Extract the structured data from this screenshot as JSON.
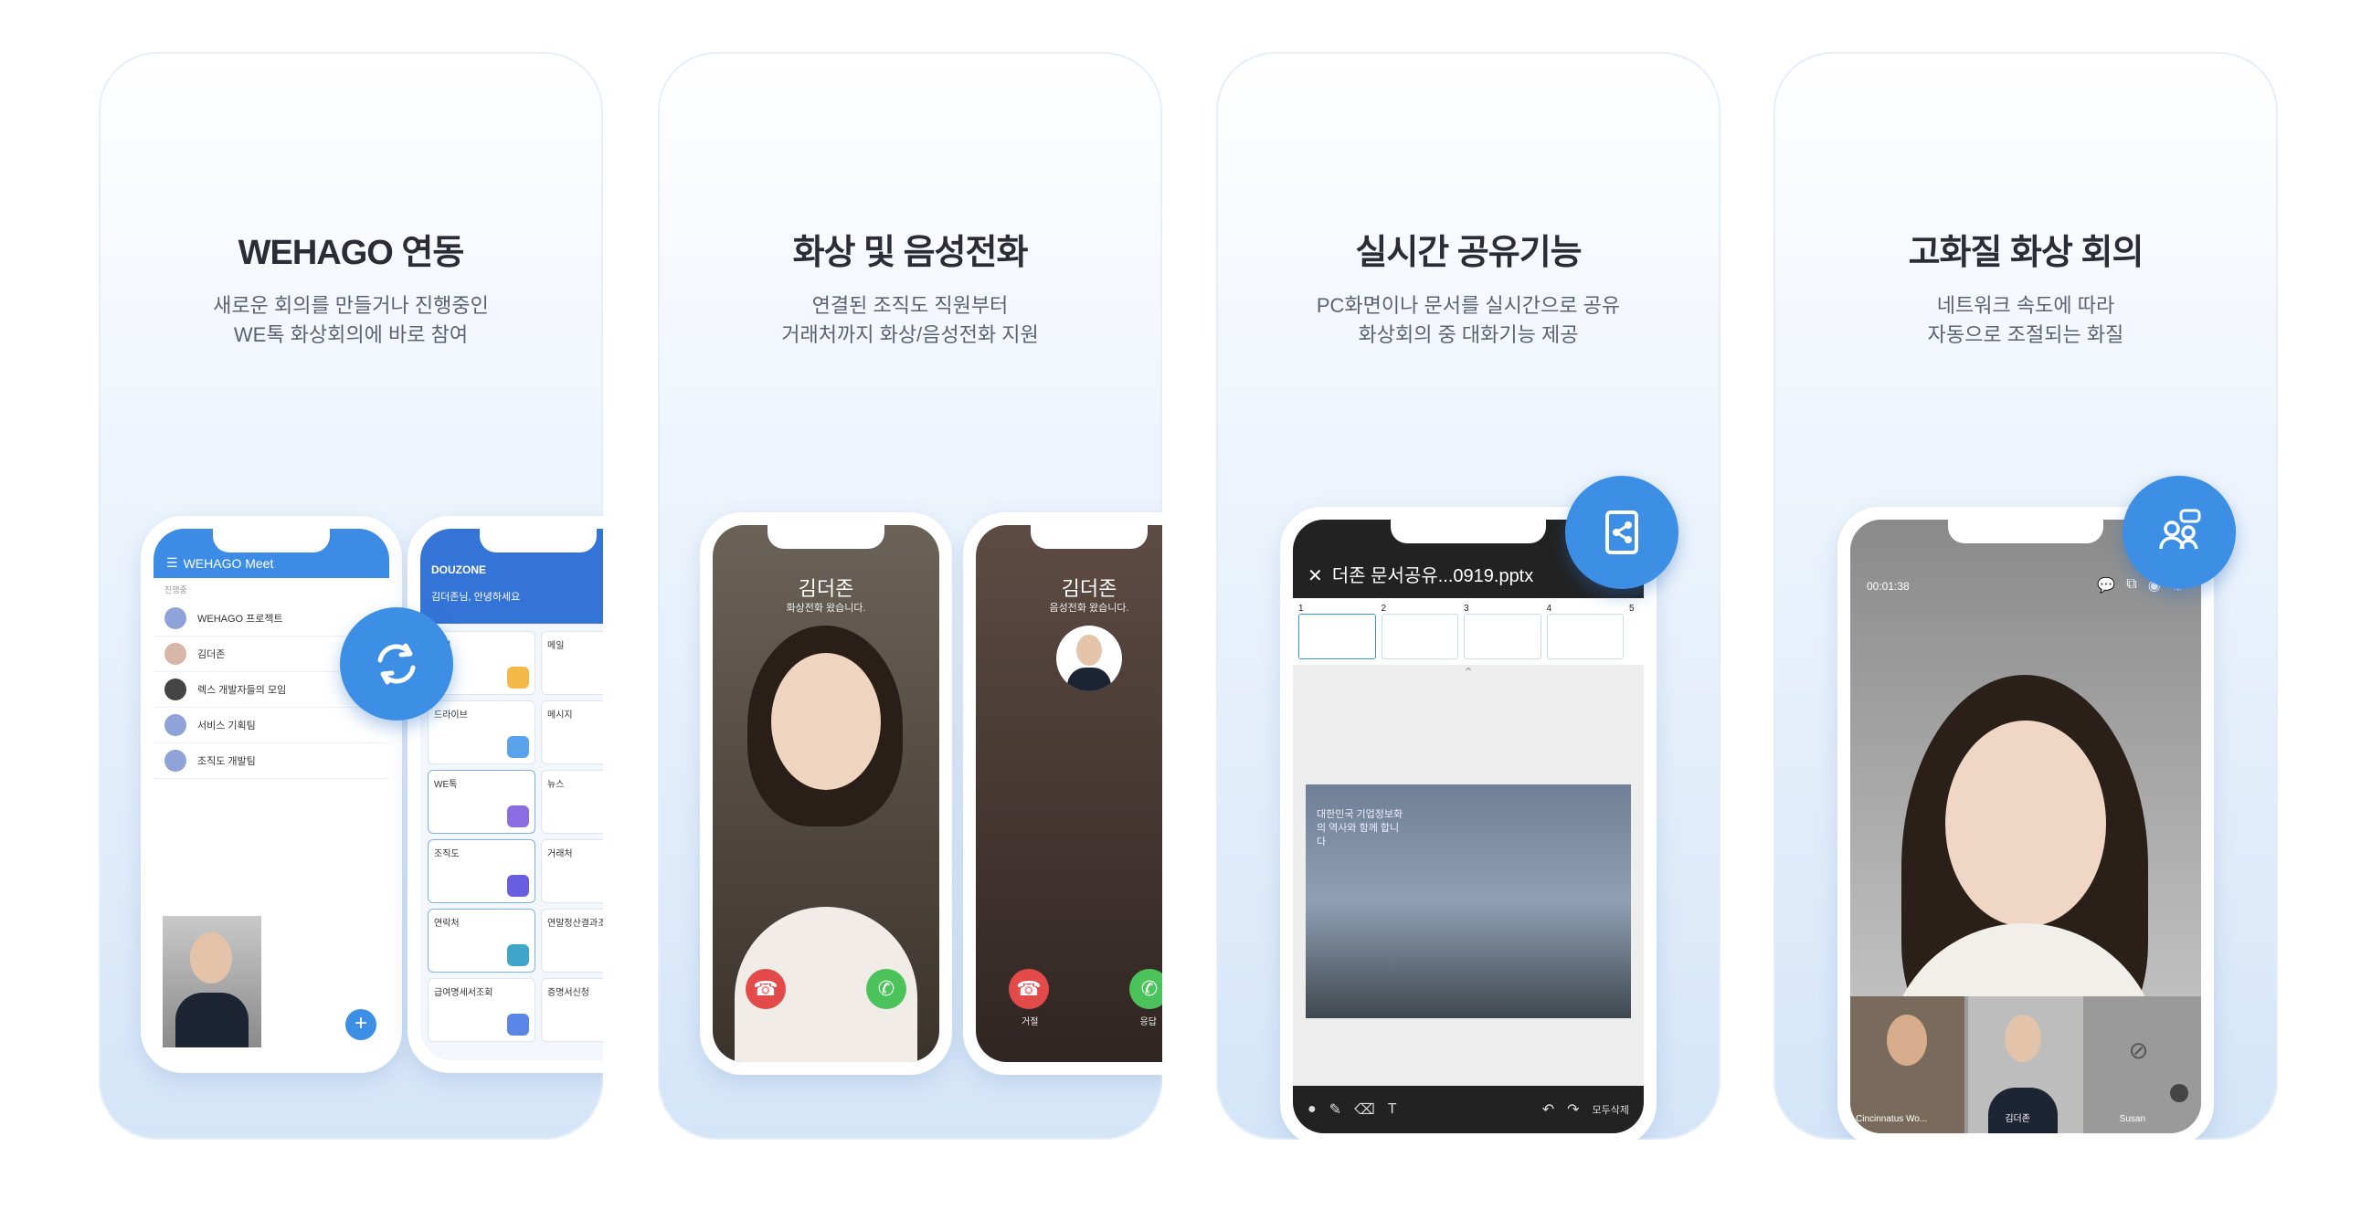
{
  "cards": [
    {
      "title": "WEHAGO 연동",
      "sub1": "새로운 회의를 만들거나 진행중인",
      "sub2": "WE톡 화상회의에 바로 참여"
    },
    {
      "title": "화상 및 음성전화",
      "sub1": "연결된 조직도 직원부터",
      "sub2": "거래처까지 화상/음성전화 지원"
    },
    {
      "title": "실시간 공유기능",
      "sub1": "PC화면이나 문서를 실시간으로 공유",
      "sub2": "화상회의 중 대화기능 제공"
    },
    {
      "title": "고화질 화상 회의",
      "sub1": "네트워크 속도에 따라",
      "sub2": "자동으로 조절되는 화질"
    }
  ],
  "meet_app": {
    "title": "WEHAGO Meet",
    "section": "진행중",
    "items": [
      "WEHAGO 프로젝트",
      "김더존",
      "렉스 개발자들의 모임",
      "서비스 기획팀",
      "조직도 개발팀"
    ],
    "fab": "+"
  },
  "douzone_app": {
    "brand": "DOUZONE",
    "greeting": "김더존님, 안녕하세요",
    "tiles": [
      "일정",
      "메일",
      "드라이브",
      "메시지",
      "WE톡",
      "뉴스",
      "조직도",
      "거래처",
      "연락처",
      "연말정산결과조회",
      "급여명세서조회",
      "증명서신청"
    ]
  },
  "calls": [
    {
      "name": "김더존",
      "status": "화상전화 왔습니다.",
      "decline": "거절",
      "accept": "응답"
    },
    {
      "name": "김더존",
      "status": "음성전화 왔습니다.",
      "decline": "거절",
      "accept": "응답"
    }
  ],
  "share_app": {
    "title": "더존 문서공유...0919.pptx",
    "pages": [
      "1",
      "2",
      "3",
      "4",
      "5"
    ],
    "slide_heading": "대한민국 기업정보화의 역사와 함께 합니다",
    "clear_all": "모두삭제"
  },
  "video_app": {
    "timer": "00:01:38",
    "participants": [
      "Cincinnatus Wo...",
      "김더존",
      "Susan"
    ]
  },
  "colors": {
    "accent": "#3d8fe6",
    "decline": "#e34b4b",
    "accept": "#4cc35a"
  },
  "icons": [
    "refresh-icon",
    "share-doc-icon",
    "participants-icon",
    "phone-decline-icon",
    "phone-accept-icon"
  ]
}
